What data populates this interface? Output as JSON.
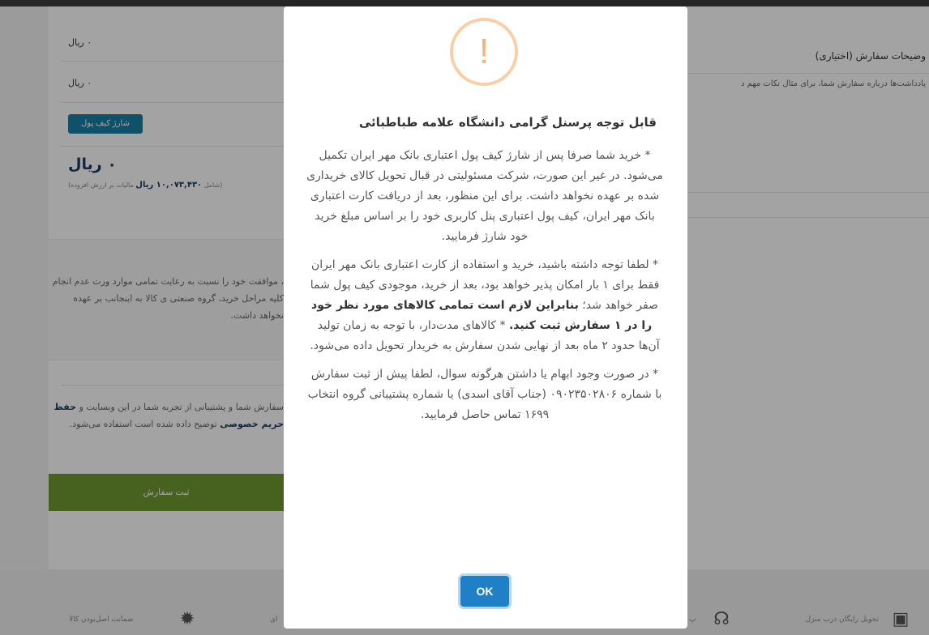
{
  "background": {
    "price_rows": [
      "۰ ریال",
      "۰ ریال"
    ],
    "wallet_button": "شارژ کیف پول",
    "total": "۰ ریال",
    "total_note_prefix": "(شامل",
    "total_note_amount": "۱۰,۰۷۳,۴۳۰ ریال",
    "total_note_suffix": "مالیات بر ارزش افزوده)",
    "terms_text": "، موافقت خود را نسبت به رعایت تمامی موارد ورت عدم انجام کلیه مراحل خرید، گروه صنعتی ی کالا به اینجانب بر عهده نخواهد داشت.",
    "privacy_text_1": "سفارش شما و پشتیبانی از تجربه شما در این وبسایت و",
    "privacy_link": "حفظ حریم خصوصی",
    "privacy_text_2": "توضیح داده شده است استفاده می‌شود.",
    "submit_button": "ثبت سفارش",
    "notes_label": "وضیحات سفارش (اختیاری)",
    "notes_hint": "یادداشت‌ها درباره سفارش شما، برای مثال نکات مهم د",
    "footer": {
      "free_delivery": "تحویل رایگان درب منزل",
      "original_guarantee": "ضمانت اصل‌بودن کالا",
      "partial_left": "ای",
      "partial_right": "پ"
    }
  },
  "modal": {
    "icon": "warning-exclamation-icon",
    "title": "قابل توجه پرسنل گرامی دانشگاه علامه طباطبائی",
    "para1": "* خرید شما صرفا پس از شارژ کیف پول اعتباری بانک مهر ایران تکمیل می‌شود. در غیر این صورت، شرکت مسئولیتی در قبال تحویل کالای خریداری شده بر عهده نخواهد داشت. برای این منظور، بعد از دریافت کارت اعتباری بانک مهر ایران، کیف پول اعتباری پنل کاربری خود را بر اساس مبلغ خرید خود شارژ فرمایید.",
    "para2_start": "* لطفا توجه داشته باشید، خرید و استفاده از کارت اعتباری بانک مهر ایران فقط برای ۱ بار امکان پذیر خواهد بود، بعد از خرید، موجودی کیف پول شما صفر خواهد شد؛",
    "para2_bold": "بنابراین لازم است تمامی کالاهای مورد نظر خود را در ۱ سفارش ثبت کنید.",
    "para2_end": "* کالاهای مدت‌دار، با توجه به زمان تولید آن‌ها حدود ۲ ماه بعد از نهایی شدن سفارش به خریدار تحویل داده می‌شود.",
    "para3": "* در صورت وجود ابهام یا داشتن هرگونه سوال، لطفا پیش از ثبت سفارش با شماره ۰۹۰۲۳۵۰۲۸۰۶ (جناب آقای اسدی) یا شماره پشتیبانی گروه انتخاب ۱۶۹۹ تماس حاصل فرمایید.",
    "ok_button": "OK"
  },
  "colors": {
    "accent": "#1f80c8",
    "warning": "#f5b37a",
    "submit": "#6f9a2f",
    "wallet": "#1a7fa6"
  }
}
